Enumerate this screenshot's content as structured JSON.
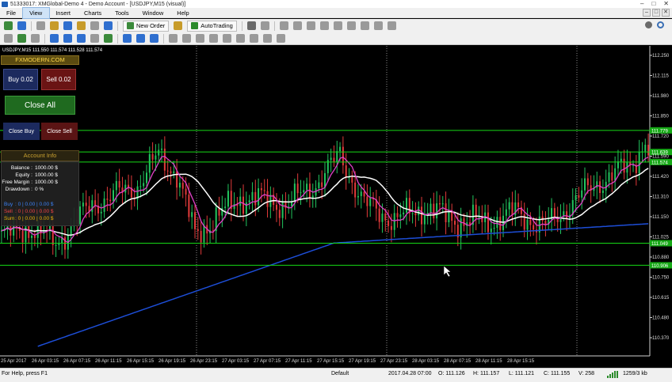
{
  "window": {
    "title": "51333017: XMGlobal-Demo 4 - Demo Account - [USDJPY,M15 (visual)]",
    "controls": [
      "–",
      "□",
      "✕"
    ]
  },
  "menu": {
    "items": [
      "File",
      "View",
      "Insert",
      "Charts",
      "Tools",
      "Window",
      "Help"
    ],
    "selected": "View"
  },
  "toolbar": {
    "new_order": "New Order",
    "auto_trading": "AutoTrading"
  },
  "chart": {
    "symbol_info": "USDJPY,M15  111.550 111.574 111.528 111.574",
    "price_labels": [
      "112.250",
      "112.115",
      "111.980",
      "111.850",
      "111.720",
      "111.590",
      "111.420",
      "111.310",
      "111.150",
      "111.025",
      "110.880",
      "110.750",
      "110.615",
      "110.480",
      "110.370"
    ],
    "time_labels": [
      "25 Apr 2017",
      "26 Apr 03:15",
      "26 Apr 07:15",
      "26 Apr 11:15",
      "26 Apr 15:15",
      "26 Apr 19:15",
      "26 Apr 23:15",
      "27 Apr 03:15",
      "27 Apr 07:15",
      "27 Apr 11:15",
      "27 Apr 15:15",
      "27 Apr 19:15",
      "27 Apr 23:15",
      "28 Apr 03:15",
      "28 Apr 07:15",
      "28 Apr 11:15",
      "28 Apr 15:15"
    ],
    "hline_labels": [
      "111.779",
      "111.639",
      "111.574",
      "111.049",
      "110.906"
    ],
    "colors": {
      "bull": "#22c55e",
      "bear": "#e23a3a",
      "ma_fast": "#e040c8",
      "ma_mid": "#ffffff",
      "ma_slow": "#1d4ed8",
      "hline": "#16d916",
      "grid": "#8a8a8a"
    }
  },
  "panel": {
    "brand": "FXMODERN.COM",
    "buy": "Buy 0.02",
    "sell": "Sell 0.02",
    "close_all": "Close All",
    "close_buy": "Close Buy",
    "close_sell": "Close Sell",
    "account_header": "Account Info",
    "account": [
      {
        "label": "Balance :",
        "value": "1000.00 $"
      },
      {
        "label": "Equity :",
        "value": "1000.00 $"
      },
      {
        "label": "Free Margin :",
        "value": "1000.00 $"
      },
      {
        "label": "Drawdown :",
        "value": "0 %"
      }
    ],
    "positions": [
      {
        "label": "Buy",
        "value": ": 0 | 0.00 | 0.00 $",
        "color": "#3b82f6"
      },
      {
        "label": "Sell",
        "value": ": 0 | 0.00 | 0.00 $",
        "color": "#ef4444"
      },
      {
        "label": "Sum",
        "value": ": 0 | 0.00 | 0.00 $",
        "color": "#eab308"
      }
    ]
  },
  "status": {
    "help": "For Help, press F1",
    "profile": "Default",
    "datetime": "2017.04.28 07:00",
    "open": "O: 111.126",
    "high": "H: 111.157",
    "low": "L: 111.121",
    "close": "C: 111.155",
    "volume": "V: 258",
    "traffic": "1259/3 kb"
  }
}
